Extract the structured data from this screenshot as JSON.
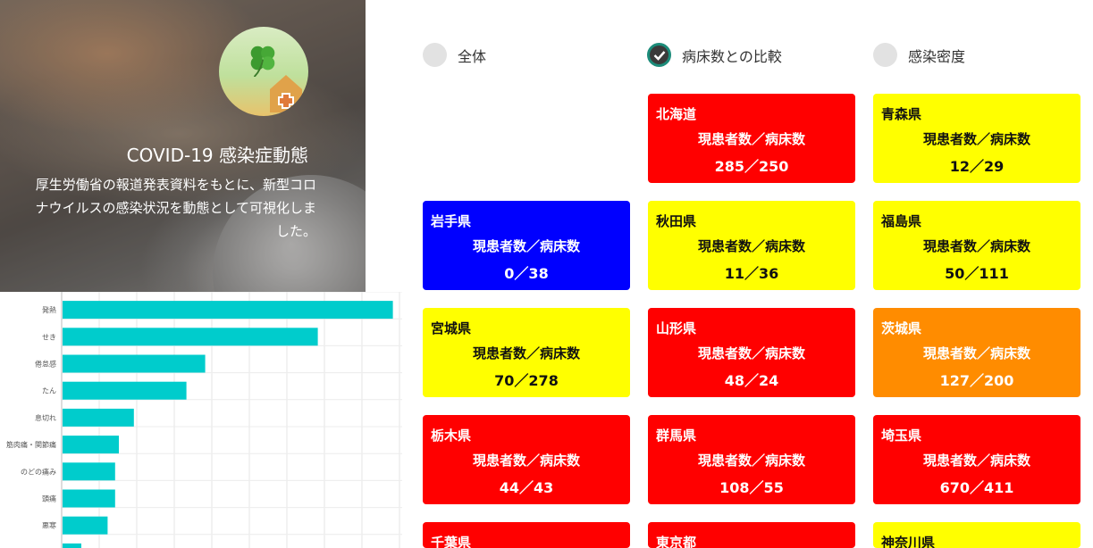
{
  "hero": {
    "title": "COVID-19 感染症動態",
    "desc_lines": [
      "厚生労働省の報道発表資料をもとに、新型コロ",
      "ナウイルスの感染状況を動態として可視化しま",
      "した。"
    ]
  },
  "radios": [
    {
      "label": "全体",
      "checked": false
    },
    {
      "label": "病床数との比較",
      "checked": true
    },
    {
      "label": "感染密度",
      "checked": false
    }
  ],
  "card_sub_label": "現患者数／病床数",
  "colors": {
    "red": "#ff0000",
    "yellow": "#ffff00",
    "blue": "#0000ff",
    "orange": "#ff8c00",
    "bar": "#00cccc",
    "accent": "#1c8c7a"
  },
  "cards": [
    {
      "pref": "北海道",
      "value": "285／250",
      "status": "red"
    },
    {
      "pref": "青森県",
      "value": "12／29",
      "status": "yellow"
    },
    {
      "pref": "岩手県",
      "value": "0／38",
      "status": "blue"
    },
    {
      "pref": "秋田県",
      "value": "11／36",
      "status": "yellow"
    },
    {
      "pref": "福島県",
      "value": "50／111",
      "status": "yellow"
    },
    {
      "pref": "宮城県",
      "value": "70／278",
      "status": "yellow"
    },
    {
      "pref": "山形県",
      "value": "48／24",
      "status": "red"
    },
    {
      "pref": "茨城県",
      "value": "127／200",
      "status": "orange"
    },
    {
      "pref": "栃木県",
      "value": "44／43",
      "status": "red"
    },
    {
      "pref": "群馬県",
      "value": "108／55",
      "status": "red"
    },
    {
      "pref": "埼玉県",
      "value": "670／411",
      "status": "red"
    },
    {
      "pref": "千葉県",
      "value": "",
      "status": "red"
    },
    {
      "pref": "東京都",
      "value": "",
      "status": "red"
    },
    {
      "pref": "神奈川県",
      "value": "",
      "status": "yellow"
    }
  ],
  "chart_data": {
    "type": "bar",
    "orientation": "horizontal",
    "categories": [
      "発熱",
      "せき",
      "倦怠感",
      "たん",
      "息切れ",
      "筋肉痛・関節痛",
      "のどの痛み",
      "頭痛",
      "悪寒",
      ""
    ],
    "values": [
      88,
      68,
      38,
      33,
      19,
      15,
      14,
      14,
      12,
      5
    ],
    "xlim": [
      0,
      90
    ],
    "grid": true
  }
}
